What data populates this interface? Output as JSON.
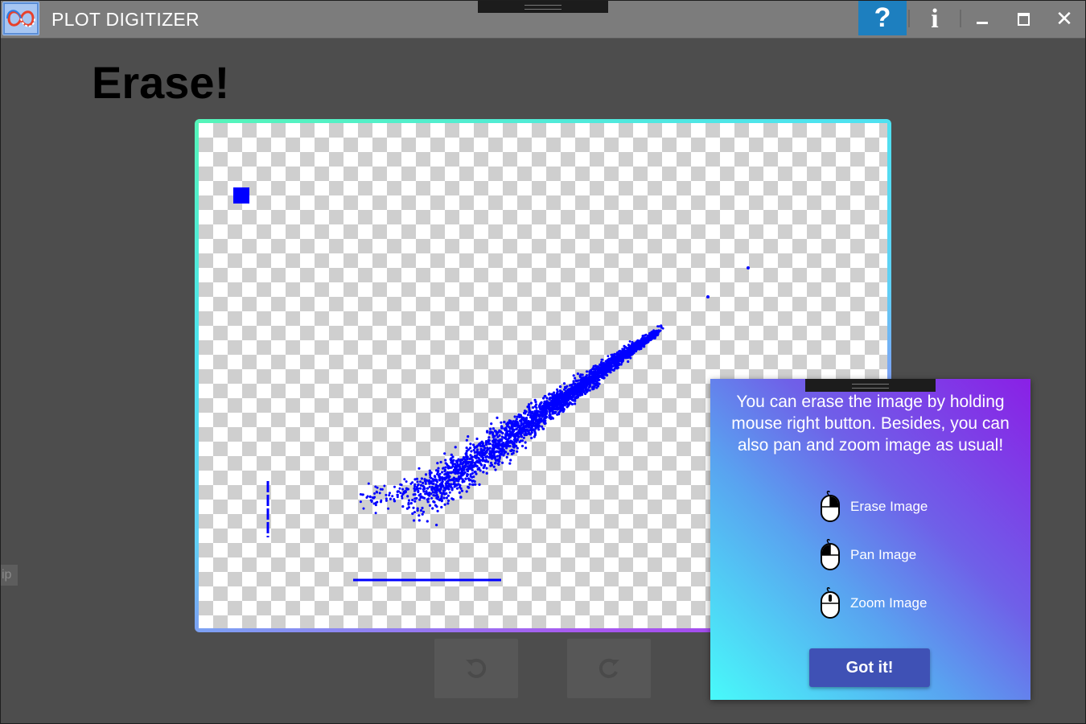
{
  "app": {
    "title": "PLOT DIGITIZER",
    "logo_icon": "infinity-logo-icon",
    "help_label": "?",
    "info_label": "i",
    "close_label": "✕"
  },
  "page": {
    "heading": "Erase!",
    "side_tip_label": "ip"
  },
  "toolbar": {
    "undo_icon": "undo-icon",
    "redo_icon": "redo-icon"
  },
  "tooltip": {
    "message": "You can erase the image by holding mouse right button. Besides, you can also pan and zoom image as usual!",
    "actions": [
      {
        "label": "Erase Image",
        "icon": "mouse-right-button-icon"
      },
      {
        "label": "Pan Image",
        "icon": "mouse-left-button-icon"
      },
      {
        "label": "Zoom Image",
        "icon": "mouse-wheel-icon"
      }
    ],
    "confirm_label": "Got it!"
  },
  "colors": {
    "accent": "#1d7fbf",
    "plot_points": "#0000ff",
    "button": "#3f51b5"
  }
}
